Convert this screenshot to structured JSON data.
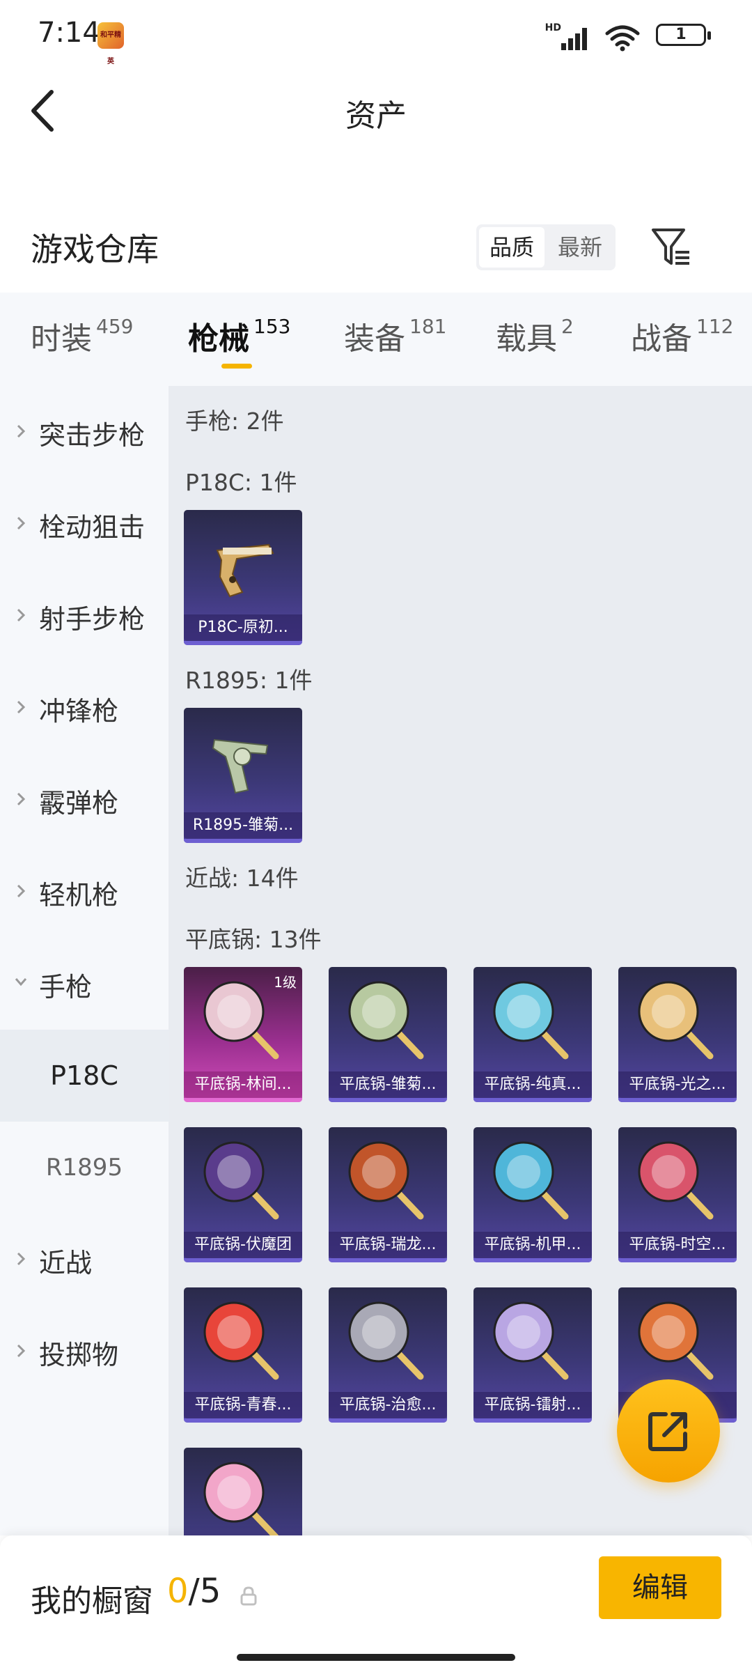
{
  "status_bar": {
    "time": "7:14",
    "app_icon_text": "和平精英",
    "network_label": "HD",
    "battery": "1"
  },
  "header": {
    "title": "资产"
  },
  "warehouse": {
    "title": "游戏仓库",
    "sort_options": [
      "品质",
      "最新"
    ],
    "active_sort": "品质"
  },
  "tabs": [
    {
      "label": "时装",
      "count": "459"
    },
    {
      "label": "枪械",
      "count": "153"
    },
    {
      "label": "装备",
      "count": "181"
    },
    {
      "label": "载具",
      "count": "2"
    },
    {
      "label": "战备",
      "count": "112"
    }
  ],
  "active_tab": "枪械",
  "sidebar": {
    "categories": [
      {
        "label": "突击步枪"
      },
      {
        "label": "栓动狙击"
      },
      {
        "label": "射手步枪"
      },
      {
        "label": "冲锋枪"
      },
      {
        "label": "霰弹枪"
      },
      {
        "label": "轻机枪"
      },
      {
        "label": "手枪"
      }
    ],
    "subitems": [
      {
        "label": "P18C"
      },
      {
        "label": "R1895"
      }
    ],
    "after": [
      {
        "label": "近战"
      },
      {
        "label": "投掷物"
      }
    ],
    "active_sub": "P18C"
  },
  "content": {
    "pistol_header": "手枪: 2件",
    "p18c_header": "P18C: 1件",
    "p18c_items": [
      {
        "name": "P18C-原初...",
        "icon": "pistol-gold-icon"
      }
    ],
    "r1895_header": "R1895: 1件",
    "r1895_items": [
      {
        "name": "R1895-雏菊...",
        "icon": "revolver-icon"
      }
    ],
    "melee_header": "近战: 14件",
    "pan_header": "平底锅: 13件",
    "pan_items": [
      {
        "name": "平底锅-林间...",
        "level": "1级",
        "rarity": "pink",
        "color": "#e9c7d2"
      },
      {
        "name": "平底锅-雏菊...",
        "color": "#b7c9a0"
      },
      {
        "name": "平底锅-纯真...",
        "color": "#6fc9e0"
      },
      {
        "name": "平底锅-光之...",
        "color": "#e8c07a"
      },
      {
        "name": "平底锅-伏魔团",
        "color": "#5a3c8c"
      },
      {
        "name": "平底锅-瑞龙...",
        "color": "#c1552a"
      },
      {
        "name": "平底锅-机甲...",
        "color": "#4fb6d9"
      },
      {
        "name": "平底锅-时空...",
        "color": "#d9546b"
      },
      {
        "name": "平底锅-青春...",
        "color": "#e8453a"
      },
      {
        "name": "平底锅-治愈...",
        "color": "#a9a9b6"
      },
      {
        "name": "平底锅-镭射...",
        "color": "#b9a6e3"
      },
      {
        "name": "平底锅-...",
        "color": "#e0743a"
      },
      {
        "name": "",
        "color": "#f2a6c9"
      }
    ]
  },
  "showcase": {
    "label": "我的橱窗",
    "current": "0",
    "separator": "/",
    "total": "5",
    "edit_label": "编辑"
  }
}
